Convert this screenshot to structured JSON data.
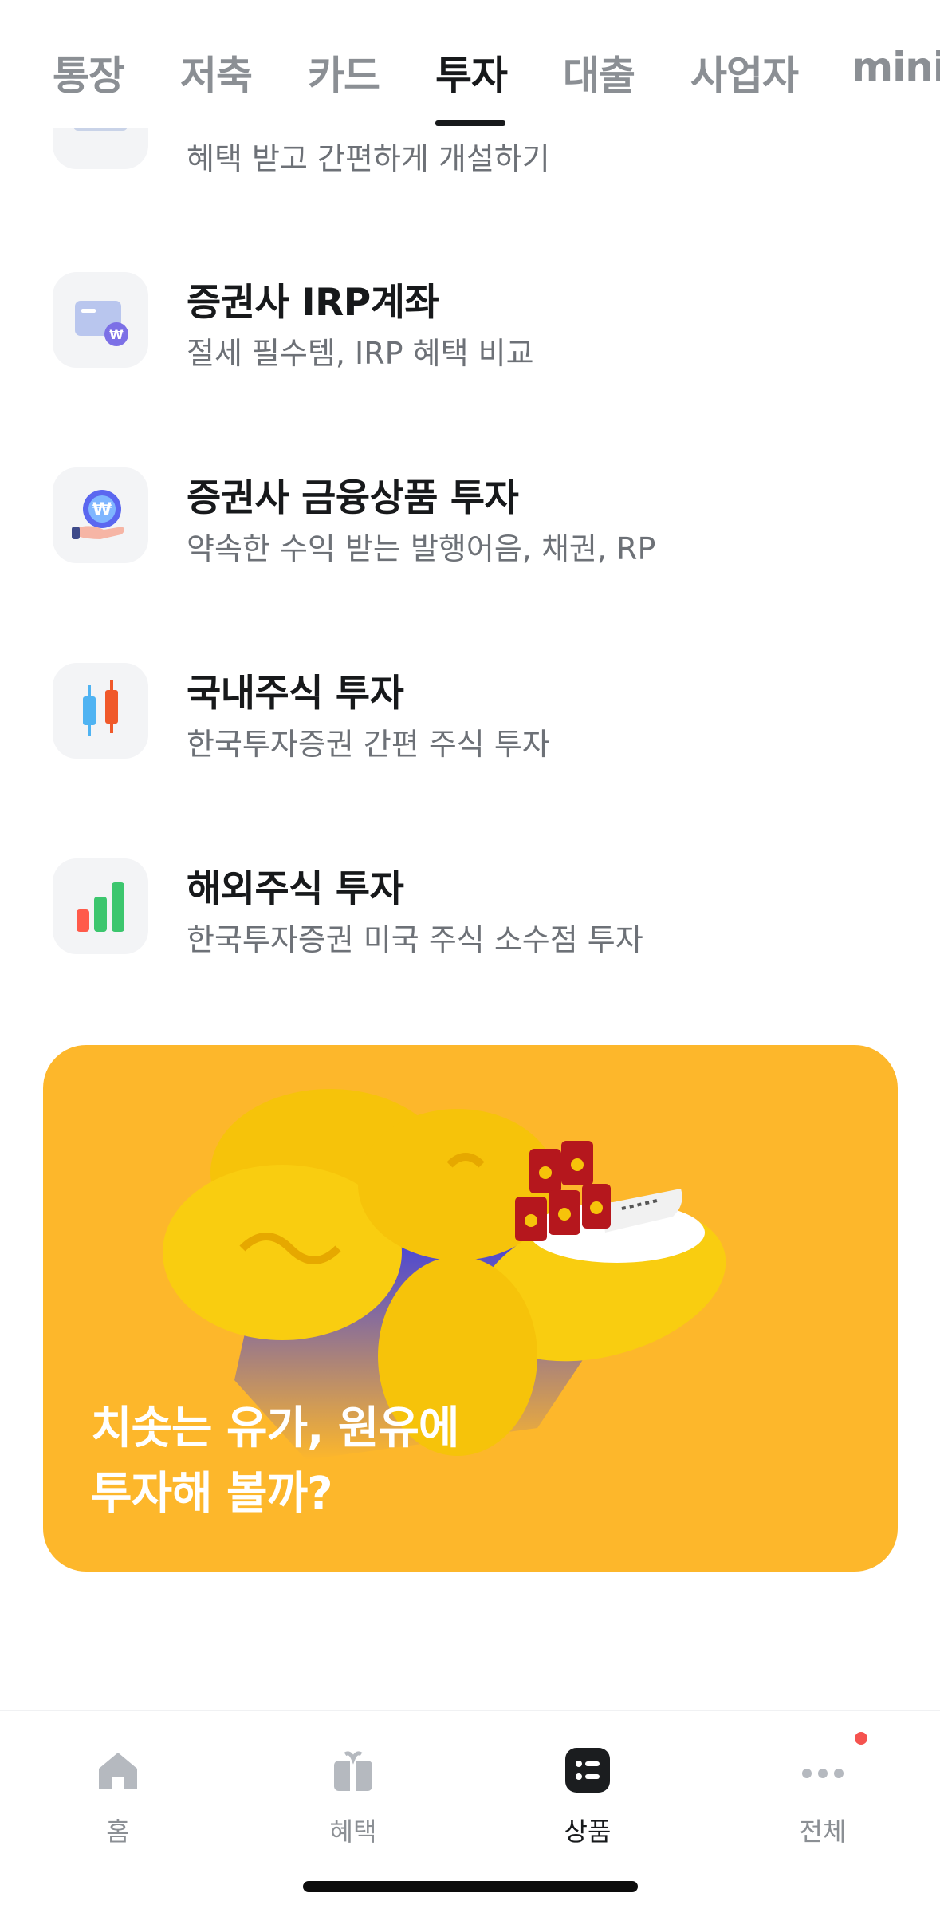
{
  "tabs": [
    {
      "label": "통장"
    },
    {
      "label": "저축"
    },
    {
      "label": "카드"
    },
    {
      "label": "투자",
      "active": true
    },
    {
      "label": "대출"
    },
    {
      "label": "사업자"
    },
    {
      "label": "mini"
    }
  ],
  "products": [
    {
      "title": "",
      "subtitle": "혜택 받고 간편하게 개설하기",
      "icon": "keyboard-icon"
    },
    {
      "title": "증권사 IRP계좌",
      "subtitle": "절세 필수템, IRP 혜택 비교",
      "icon": "irp-card-icon"
    },
    {
      "title": "증권사 금융상품 투자",
      "subtitle": "약속한 수익 받는 발행어음, 채권, RP",
      "icon": "won-coin-hand-icon"
    },
    {
      "title": "국내주식 투자",
      "subtitle": "한국투자증권 간편 주식 투자",
      "icon": "candlestick-icon"
    },
    {
      "title": "해외주식 투자",
      "subtitle": "한국투자증권 미국 주식 소수점 투자",
      "icon": "bar-chart-icon"
    }
  ],
  "banner": {
    "line1": "치솟는 유가, 원유에",
    "line2": "투자해 볼까?",
    "color": "#fdb72b"
  },
  "bottom_nav": [
    {
      "label": "홈",
      "icon": "home-icon"
    },
    {
      "label": "혜택",
      "icon": "gift-icon"
    },
    {
      "label": "상품",
      "icon": "products-icon",
      "active": true
    },
    {
      "label": "전체",
      "icon": "more-icon",
      "badge": true
    }
  ]
}
